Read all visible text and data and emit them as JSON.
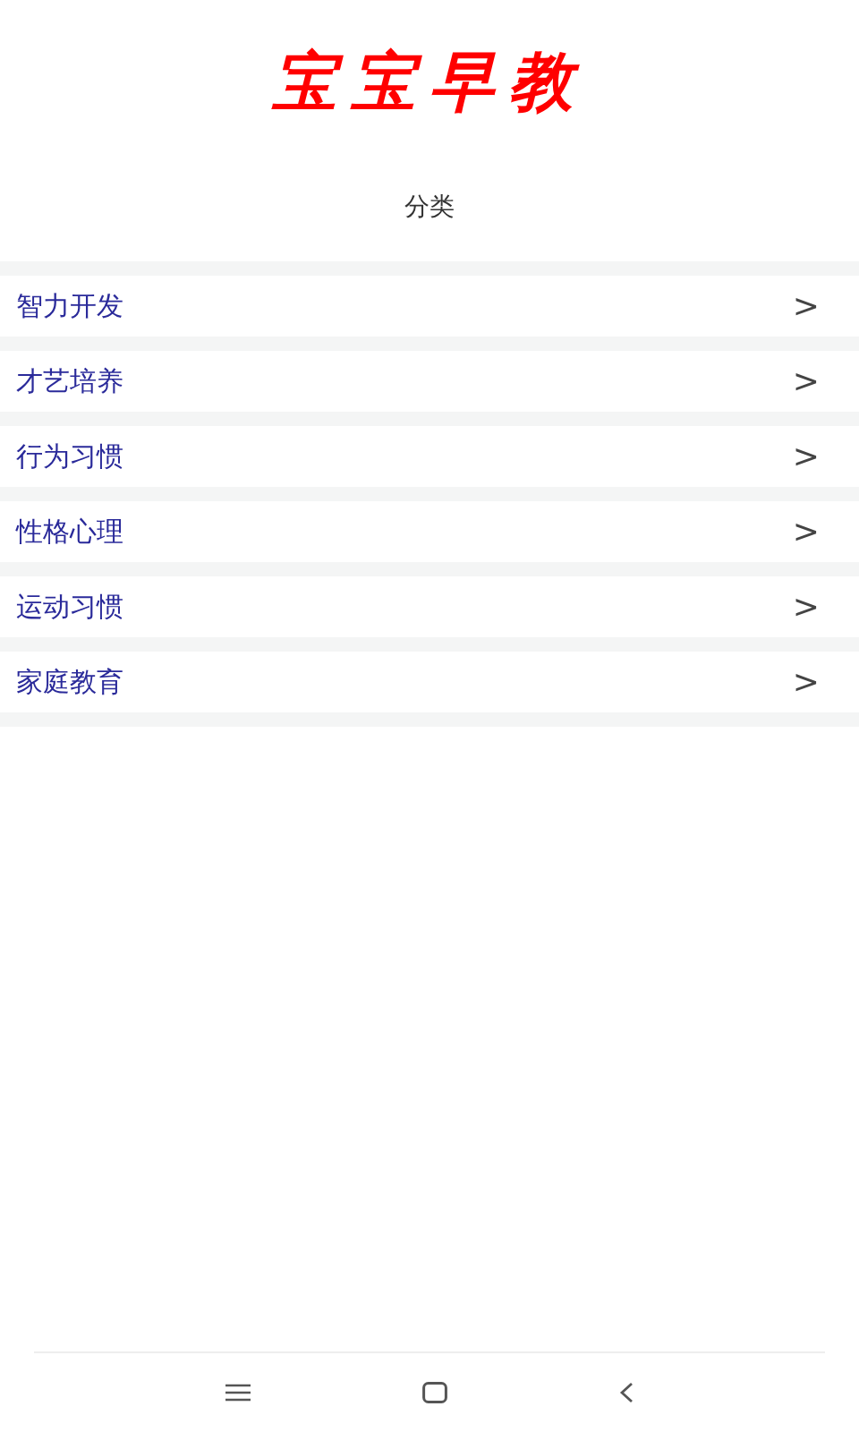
{
  "app_title": "宝宝早教",
  "section_title": "分类",
  "categories": [
    {
      "label": "智力开发",
      "arrow": ">"
    },
    {
      "label": "才艺培养",
      "arrow": ">"
    },
    {
      "label": "行为习惯",
      "arrow": ">"
    },
    {
      "label": "性格心理",
      "arrow": ">"
    },
    {
      "label": "运动习惯",
      "arrow": ">"
    },
    {
      "label": "家庭教育",
      "arrow": ">"
    }
  ]
}
